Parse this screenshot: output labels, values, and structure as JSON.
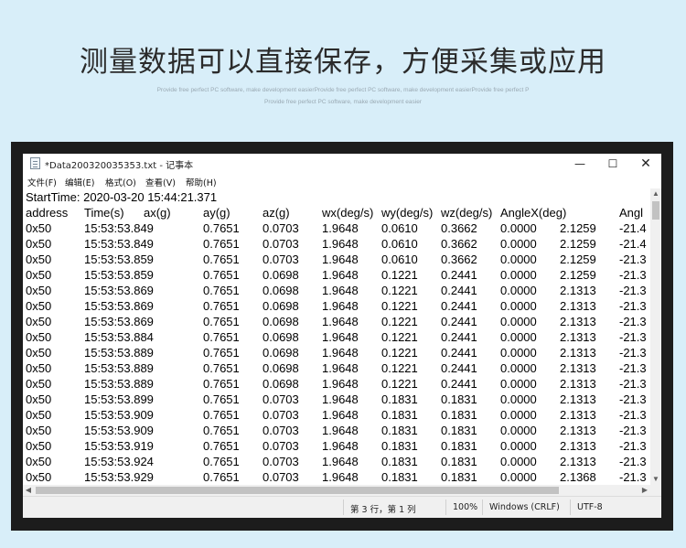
{
  "banner": {
    "headline": "测量数据可以直接保存，方便采集或应用",
    "sub_line1": "Provide free perfect PC software, make development easierProvide free perfect PC software, make development easierProvide free perfect P",
    "sub_line2": "Provide free perfect PC software, make development easier"
  },
  "window": {
    "title": "*Data200320035353.txt - 记事本",
    "min_glyph": "—",
    "max_glyph": "☐",
    "close_glyph": "✕"
  },
  "menu": [
    "文件(F)",
    "编辑(E)",
    "格式(O)",
    "查看(V)",
    "帮助(H)"
  ],
  "editor": {
    "start_line": "StartTime: 2020-03-20 15:44:21.371",
    "headers": [
      "address",
      "Time(s)",
      "ax(g)",
      "ay(g)",
      "az(g)",
      "wx(deg/s)",
      "wy(deg/s)",
      "wz(deg/s)",
      "AngleX(deg)",
      "",
      "Angl"
    ],
    "rows": [
      [
        "0x50",
        "15:53:53.849",
        "",
        "0.7651",
        "0.0703",
        "1.9648",
        "0.0610",
        "0.3662",
        "0.0000",
        "2.1259",
        "-21.4"
      ],
      [
        "0x50",
        "15:53:53.849",
        "",
        "0.7651",
        "0.0703",
        "1.9648",
        "0.0610",
        "0.3662",
        "0.0000",
        "2.1259",
        "-21.4"
      ],
      [
        "0x50",
        "15:53:53.859",
        "",
        "0.7651",
        "0.0703",
        "1.9648",
        "0.0610",
        "0.3662",
        "0.0000",
        "2.1259",
        "-21.3"
      ],
      [
        "0x50",
        "15:53:53.859",
        "",
        "0.7651",
        "0.0698",
        "1.9648",
        "0.1221",
        "0.2441",
        "0.0000",
        "2.1259",
        "-21.3"
      ],
      [
        "0x50",
        "15:53:53.869",
        "",
        "0.7651",
        "0.0698",
        "1.9648",
        "0.1221",
        "0.2441",
        "0.0000",
        "2.1313",
        "-21.3"
      ],
      [
        "0x50",
        "15:53:53.869",
        "",
        "0.7651",
        "0.0698",
        "1.9648",
        "0.1221",
        "0.2441",
        "0.0000",
        "2.1313",
        "-21.3"
      ],
      [
        "0x50",
        "15:53:53.869",
        "",
        "0.7651",
        "0.0698",
        "1.9648",
        "0.1221",
        "0.2441",
        "0.0000",
        "2.1313",
        "-21.3"
      ],
      [
        "0x50",
        "15:53:53.884",
        "",
        "0.7651",
        "0.0698",
        "1.9648",
        "0.1221",
        "0.2441",
        "0.0000",
        "2.1313",
        "-21.3"
      ],
      [
        "0x50",
        "15:53:53.889",
        "",
        "0.7651",
        "0.0698",
        "1.9648",
        "0.1221",
        "0.2441",
        "0.0000",
        "2.1313",
        "-21.3"
      ],
      [
        "0x50",
        "15:53:53.889",
        "",
        "0.7651",
        "0.0698",
        "1.9648",
        "0.1221",
        "0.2441",
        "0.0000",
        "2.1313",
        "-21.3"
      ],
      [
        "0x50",
        "15:53:53.889",
        "",
        "0.7651",
        "0.0698",
        "1.9648",
        "0.1221",
        "0.2441",
        "0.0000",
        "2.1313",
        "-21.3"
      ],
      [
        "0x50",
        "15:53:53.899",
        "",
        "0.7651",
        "0.0703",
        "1.9648",
        "0.1831",
        "0.1831",
        "0.0000",
        "2.1313",
        "-21.3"
      ],
      [
        "0x50",
        "15:53:53.909",
        "",
        "0.7651",
        "0.0703",
        "1.9648",
        "0.1831",
        "0.1831",
        "0.0000",
        "2.1313",
        "-21.3"
      ],
      [
        "0x50",
        "15:53:53.909",
        "",
        "0.7651",
        "0.0703",
        "1.9648",
        "0.1831",
        "0.1831",
        "0.0000",
        "2.1313",
        "-21.3"
      ],
      [
        "0x50",
        "15:53:53.919",
        "",
        "0.7651",
        "0.0703",
        "1.9648",
        "0.1831",
        "0.1831",
        "0.0000",
        "2.1313",
        "-21.3"
      ],
      [
        "0x50",
        "15:53:53.924",
        "",
        "0.7651",
        "0.0703",
        "1.9648",
        "0.1831",
        "0.1831",
        "0.0000",
        "2.1313",
        "-21.3"
      ],
      [
        "0x50",
        "15:53:53.929",
        "",
        "0.7651",
        "0.0703",
        "1.9648",
        "0.1831",
        "0.1831",
        "0.0000",
        "2.1368",
        "-21.3"
      ]
    ]
  },
  "statusbar": {
    "position": "第 3 行，第 1 列",
    "zoom": "100%",
    "line_ending": "Windows (CRLF)",
    "encoding": "UTF-8"
  },
  "colors": {
    "background": "#d8eef9",
    "frame": "#1c1c1c"
  }
}
